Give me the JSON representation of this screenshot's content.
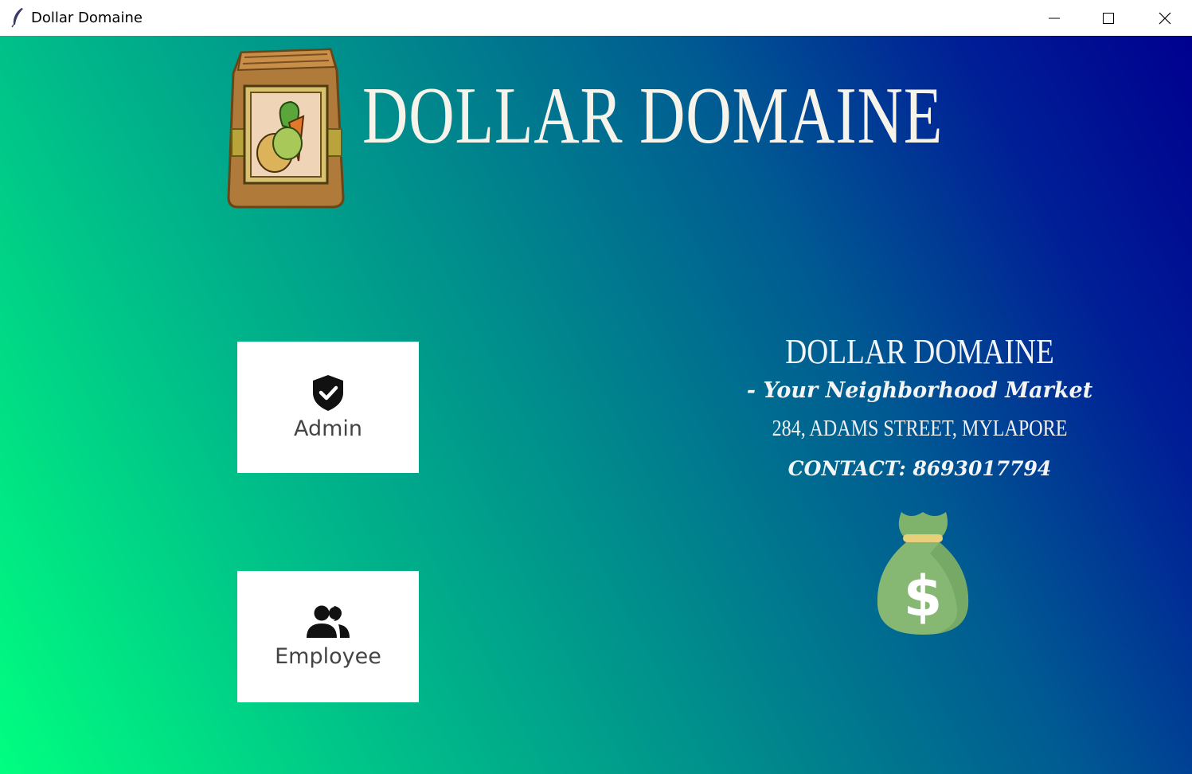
{
  "window": {
    "title": "Dollar Domaine"
  },
  "header": {
    "brand_title": "DOLLAR DOMAINE",
    "logo_icon": "grocery-bag-icon"
  },
  "roles": {
    "admin": {
      "label": "Admin",
      "icon": "shield-check-icon"
    },
    "employee": {
      "label": "Employee",
      "icon": "users-icon"
    }
  },
  "info": {
    "name": "DOLLAR DOMAINE",
    "tagline": "- Your Neighborhood Market",
    "address": "284, ADAMS STREET, MYLAPORE",
    "contact": "CONTACT: 8693017794",
    "money_icon": "money-bag-icon"
  },
  "colors": {
    "gradient_start": "#00ff80",
    "gradient_end": "#00008f",
    "button_bg": "#ffffff"
  }
}
